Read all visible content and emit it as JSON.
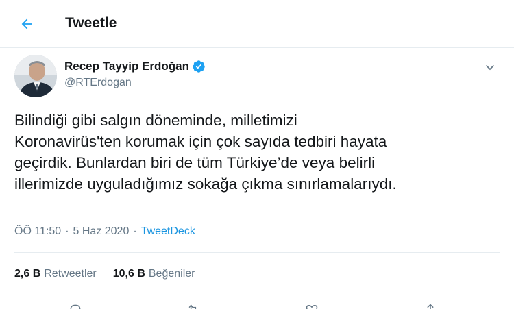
{
  "header": {
    "title": "Tweetle"
  },
  "tweet": {
    "author": {
      "display_name": "Recep Tayyip Erdoğan",
      "handle": "@RTErdogan",
      "verified": true
    },
    "text": "Bilindiği gibi salgın döneminde, milletimizi\nKoronavirüs'ten korumak için çok sayıda tedbiri hayata\ngeçirdik. Bunlardan biri de tüm Türkiye’de veya belirli\nillerimizde uyguladığımız sokağa çıkma sınırlamalarıydı.",
    "time": "ÖÖ 11:50",
    "date": "5 Haz 2020",
    "separator": "·",
    "source": "TweetDeck"
  },
  "stats": {
    "retweets": {
      "count": "2,6 B",
      "label": "Retweetler"
    },
    "likes": {
      "count": "10,6 B",
      "label": "Beğeniler"
    }
  },
  "colors": {
    "accent": "#1da1f2",
    "text": "#14171a",
    "secondary": "#657786",
    "border": "#e6ecf0"
  },
  "icons": [
    "back-arrow-icon",
    "verified-badge-icon",
    "chevron-down-icon",
    "reply-icon",
    "retweet-icon",
    "like-icon",
    "share-icon"
  ]
}
